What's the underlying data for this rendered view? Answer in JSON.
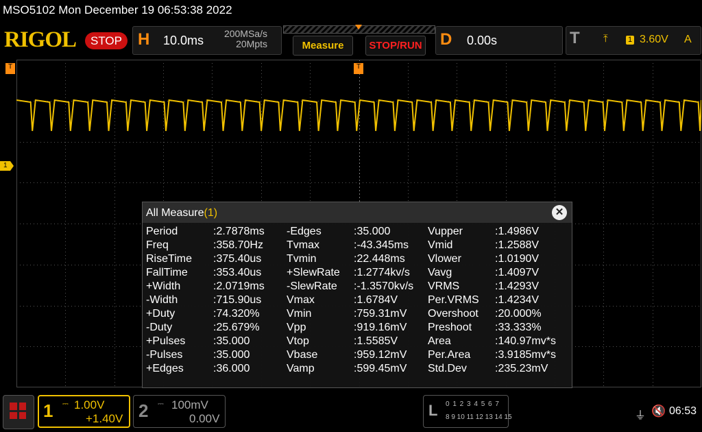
{
  "window": {
    "title": "MSO5102  Mon December 19 06:53:38 2022"
  },
  "brand": {
    "logo": "RIGOL",
    "run_state": "STOP"
  },
  "horizontal": {
    "letter": "H",
    "timebase": "10.0ms",
    "sample_rate": "200MSa/s",
    "memory_depth": "20Mpts"
  },
  "buttons": {
    "measure": "Measure",
    "stop_run": "STOP/RUN"
  },
  "delay": {
    "letter": "D",
    "value": "0.00s"
  },
  "trigger": {
    "letter": "T",
    "edge_icon": "rising-edge-icon",
    "edge_glyph": "⤒",
    "source": "1",
    "level": "3.60V",
    "mode": "A"
  },
  "markers": {
    "channel1": "1",
    "trigger_left": "T",
    "trigger_top": "T"
  },
  "measure_panel": {
    "title": "All Measure",
    "channel": "(1)",
    "close_glyph": "✕",
    "columns": [
      [
        {
          "label": "Period",
          "value": ":2.7878ms"
        },
        {
          "label": "Freq",
          "value": ":358.70Hz"
        },
        {
          "label": "RiseTime",
          "value": ":375.40us"
        },
        {
          "label": "FallTime",
          "value": ":353.40us"
        },
        {
          "label": "+Width",
          "value": ":2.0719ms"
        },
        {
          "label": "-Width",
          "value": ":715.90us"
        },
        {
          "label": "+Duty",
          "value": ":74.320%"
        },
        {
          "label": "-Duty",
          "value": ":25.679%"
        },
        {
          "label": "+Pulses",
          "value": ":35.000"
        },
        {
          "label": "-Pulses",
          "value": ":35.000"
        },
        {
          "label": "+Edges",
          "value": ":36.000"
        }
      ],
      [
        {
          "label": "-Edges",
          "value": ":35.000"
        },
        {
          "label": "Tvmax",
          "value": ":-43.345ms"
        },
        {
          "label": "Tvmin",
          "value": ":22.448ms"
        },
        {
          "label": "+SlewRate",
          "value": ":1.2774kv/s"
        },
        {
          "label": "-SlewRate",
          "value": ":-1.3570kv/s"
        },
        {
          "label": "Vmax",
          "value": ":1.6784V"
        },
        {
          "label": "Vmin",
          "value": ":759.31mV"
        },
        {
          "label": "Vpp",
          "value": ":919.16mV"
        },
        {
          "label": "Vtop",
          "value": ":1.5585V"
        },
        {
          "label": "Vbase",
          "value": ":959.12mV"
        },
        {
          "label": "Vamp",
          "value": ":599.45mV"
        }
      ],
      [
        {
          "label": "Vupper",
          "value": ":1.4986V"
        },
        {
          "label": "Vmid",
          "value": ":1.2588V"
        },
        {
          "label": "Vlower",
          "value": ":1.0190V"
        },
        {
          "label": "Vavg",
          "value": ":1.4097V"
        },
        {
          "label": "VRMS",
          "value": ":1.4293V"
        },
        {
          "label": "Per.VRMS",
          "value": ":1.4234V"
        },
        {
          "label": "Overshoot",
          "value": ":20.000%"
        },
        {
          "label": "Preshoot",
          "value": ":33.333%"
        },
        {
          "label": "Area",
          "value": ":140.97mv*s"
        },
        {
          "label": "Per.Area",
          "value": ":3.9185mv*s"
        },
        {
          "label": "Std.Dev",
          "value": ":235.23mV"
        }
      ]
    ]
  },
  "bottom": {
    "ch1": {
      "num": "1",
      "coupling": "DC",
      "scale": "1.00V",
      "offset": "+1.40V"
    },
    "ch2": {
      "num": "2",
      "coupling": "DC",
      "scale": "100mV",
      "offset": "0.00V"
    },
    "logic": {
      "letter": "L",
      "row1": "0 1 2 3  4 5 6 7",
      "row2": "8 9 10 11 12 13 14 15"
    },
    "usb_glyph": "⏚",
    "speaker_glyph": "🔇",
    "clock": "06:53"
  },
  "colors": {
    "ch1": "#f0c000",
    "accent": "#ff8c10",
    "stop": "#cc1010",
    "grid": "#555555"
  },
  "waveform": {
    "cycles_on_screen": 35.9,
    "duty": 0.7432
  }
}
